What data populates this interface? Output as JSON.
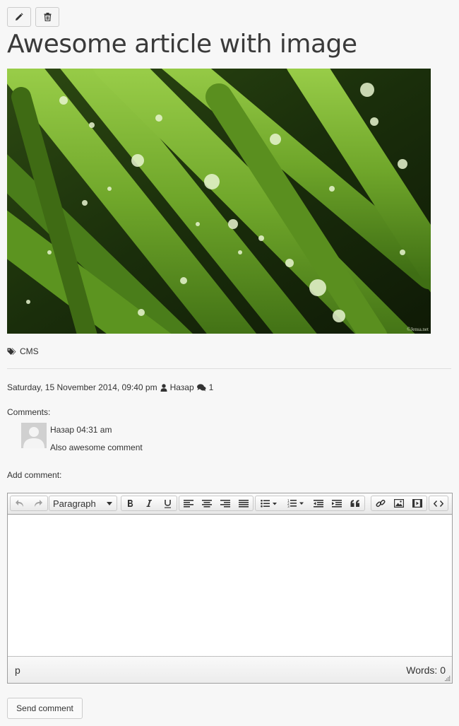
{
  "article": {
    "title": "Awesome article with image",
    "tags": [
      "CMS"
    ],
    "date": "Saturday, 15 November 2014, 09:40 pm",
    "author": "Назар",
    "comment_count": "1",
    "image_icon": "grass-with-water-drops-photo",
    "image_caption": "©Jensa.net"
  },
  "actions": {
    "edit_icon": "pencil-icon",
    "delete_icon": "trash-icon"
  },
  "comments": {
    "label": "Comments:",
    "items": [
      {
        "author": "Назар",
        "time": "04:31 am",
        "text": "Also awesome comment"
      }
    ]
  },
  "add_comment": {
    "label": "Add comment:",
    "editor": {
      "format_select": "Paragraph",
      "path": "p",
      "word_count": "Words: 0",
      "toolbar_icons": [
        "undo-icon",
        "redo-icon",
        "bold-icon",
        "italic-icon",
        "underline-icon",
        "align-left-icon",
        "align-center-icon",
        "align-right-icon",
        "justify-icon",
        "bullet-list-icon",
        "numbered-list-icon",
        "outdent-icon",
        "indent-icon",
        "blockquote-icon",
        "link-icon",
        "image-icon",
        "media-icon",
        "code-icon"
      ]
    },
    "submit_label": "Send comment"
  },
  "colors": {
    "background": "#f7f7f7",
    "border": "#cccccc",
    "text": "#333333"
  }
}
